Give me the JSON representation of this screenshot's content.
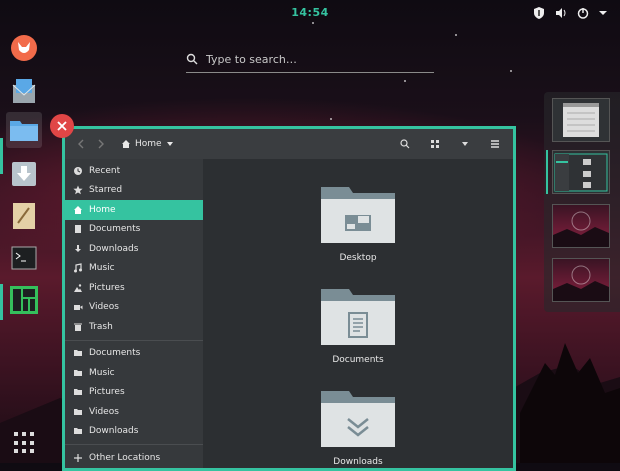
{
  "topbar": {
    "clock": "14:54"
  },
  "search": {
    "placeholder": "Type to search…"
  },
  "filemanager": {
    "location": "Home",
    "sidebar": {
      "places": [
        {
          "label": "Recent",
          "icon": "clock-icon"
        },
        {
          "label": "Starred",
          "icon": "star-icon"
        },
        {
          "label": "Home",
          "icon": "home-icon",
          "selected": true
        },
        {
          "label": "Documents",
          "icon": "document-icon"
        },
        {
          "label": "Downloads",
          "icon": "download-icon"
        },
        {
          "label": "Music",
          "icon": "music-icon"
        },
        {
          "label": "Pictures",
          "icon": "picture-icon"
        },
        {
          "label": "Videos",
          "icon": "video-icon"
        },
        {
          "label": "Trash",
          "icon": "trash-icon"
        }
      ],
      "bookmarks": [
        {
          "label": "Documents",
          "icon": "folder-icon"
        },
        {
          "label": "Music",
          "icon": "folder-icon"
        },
        {
          "label": "Pictures",
          "icon": "folder-icon"
        },
        {
          "label": "Videos",
          "icon": "folder-icon"
        },
        {
          "label": "Downloads",
          "icon": "folder-icon"
        }
      ],
      "other": {
        "label": "Other Locations",
        "icon": "plus-icon"
      }
    },
    "folders": [
      {
        "label": "Desktop",
        "icon": "desktop-folder-icon"
      },
      {
        "label": "Documents",
        "icon": "documents-folder-icon"
      },
      {
        "label": "Downloads",
        "icon": "downloads-folder-icon"
      }
    ]
  },
  "colors": {
    "accent": "#35c3a0",
    "close": "#e04646"
  }
}
